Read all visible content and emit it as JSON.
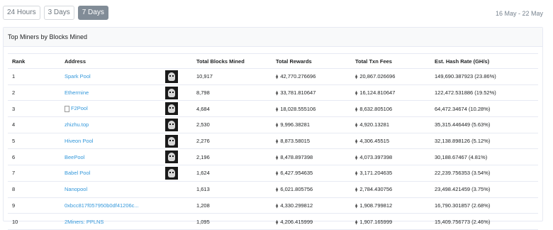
{
  "range": {
    "buttons": [
      "24 Hours",
      "3 Days",
      "7 Days"
    ],
    "active": "7 Days",
    "date_range": "16 May - 22 May"
  },
  "card": {
    "title": "Top Miners by Blocks Mined"
  },
  "table": {
    "headers": [
      "Rank",
      "Address",
      "Total Blocks Mined",
      "Total Rewards",
      "Total Txn Fees",
      "Est. Hash Rate (GH/s)"
    ],
    "rows": [
      {
        "rank": "1",
        "address": "Spark Pool",
        "blocks": "10,917",
        "rewards": "42,770.276696",
        "fees": "20,867.026696",
        "hash": "149,690.387923 (23.86%)",
        "avatar": true,
        "doc": false
      },
      {
        "rank": "2",
        "address": "Ethermine",
        "blocks": "8,798",
        "rewards": "33,781.810647",
        "fees": "16,124.810647",
        "hash": "122,472.531886 (19.52%)",
        "avatar": true,
        "doc": false
      },
      {
        "rank": "3",
        "address": "F2Pool",
        "blocks": "4,684",
        "rewards": "18,028.555106",
        "fees": "8,632.805106",
        "hash": "64,472.34674 (10.28%)",
        "avatar": true,
        "doc": true
      },
      {
        "rank": "4",
        "address": "zhizhu.top",
        "blocks": "2,530",
        "rewards": "9,996.38281",
        "fees": "4,920.13281",
        "hash": "35,315.446449 (5.63%)",
        "avatar": true,
        "doc": false
      },
      {
        "rank": "5",
        "address": "Hiveon Pool",
        "blocks": "2,276",
        "rewards": "8,873.58015",
        "fees": "4,306.45515",
        "hash": "32,138.898126 (5.12%)",
        "avatar": true,
        "doc": false
      },
      {
        "rank": "6",
        "address": "BeePool",
        "blocks": "2,196",
        "rewards": "8,478.897398",
        "fees": "4,073.397398",
        "hash": "30,188.67467 (4.81%)",
        "avatar": true,
        "doc": false
      },
      {
        "rank": "7",
        "address": "Babel Pool",
        "blocks": "1,624",
        "rewards": "6,427.954635",
        "fees": "3,171.204635",
        "hash": "22,239.756353 (3.54%)",
        "avatar": true,
        "doc": false
      },
      {
        "rank": "8",
        "address": "Nanopool",
        "blocks": "1,613",
        "rewards": "6,021.805756",
        "fees": "2,784.430756",
        "hash": "23,498.421459 (3.75%)",
        "avatar": false,
        "doc": false
      },
      {
        "rank": "9",
        "address": "0xbcc817f057950b0df41206c...",
        "blocks": "1,208",
        "rewards": "4,330.299812",
        "fees": "1,908.799812",
        "hash": "16,790.301857 (2.68%)",
        "avatar": false,
        "doc": false
      },
      {
        "rank": "10",
        "address": "2Miners: PPLNS",
        "blocks": "1,095",
        "rewards": "4,206.415999",
        "fees": "1,907.165999",
        "hash": "15,409.756773 (2.46%)",
        "avatar": false,
        "doc": false
      }
    ]
  }
}
